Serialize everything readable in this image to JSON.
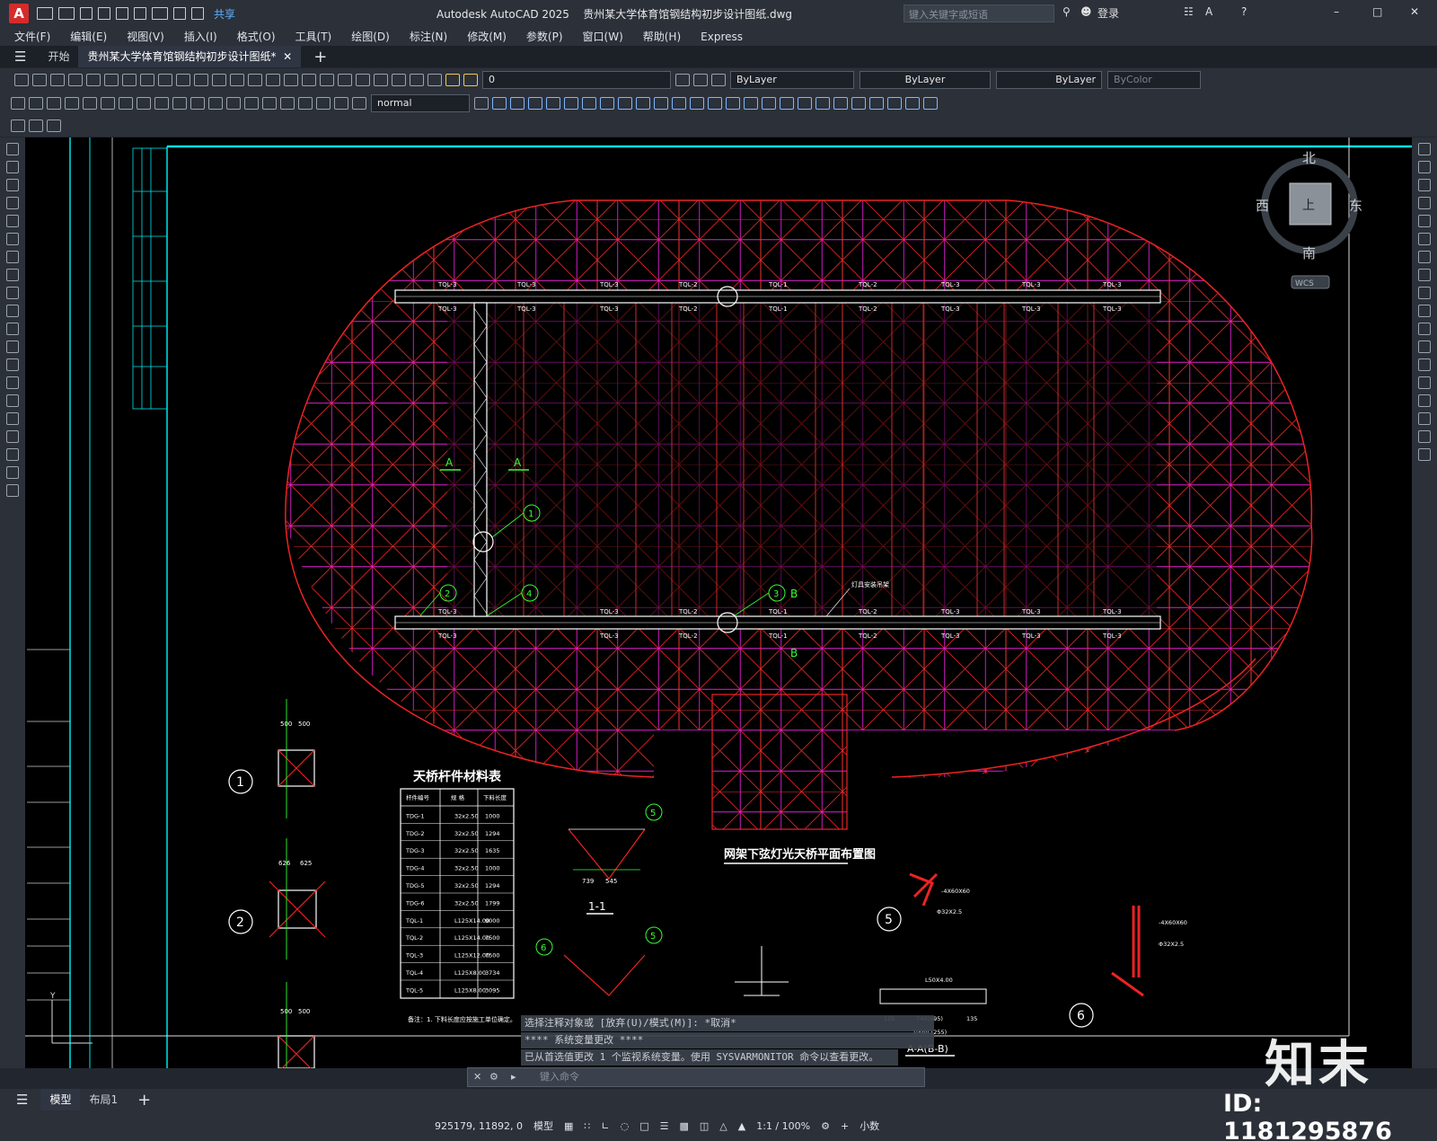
{
  "titlebar": {
    "app_name": "Autodesk AutoCAD 2025",
    "file_name": "贵州某大学体育馆钢结构初步设计图纸.dwg",
    "share_label": "共享",
    "search_placeholder": "键入关键字或短语",
    "login_label": "登录"
  },
  "menu": [
    "文件(F)",
    "编辑(E)",
    "视图(V)",
    "插入(I)",
    "格式(O)",
    "工具(T)",
    "绘图(D)",
    "标注(N)",
    "修改(M)",
    "参数(P)",
    "窗口(W)",
    "帮助(H)",
    "Express"
  ],
  "tabs": {
    "start": "开始",
    "document": "贵州某大学体育馆钢结构初步设计图纸*"
  },
  "layer": {
    "current": "0"
  },
  "properties": {
    "color": "ByLayer",
    "linetype": "ByLayer",
    "lineweight": "ByLayer",
    "plotstyle": "ByColor"
  },
  "dimstyle": "normal",
  "viewcube": {
    "north": "北",
    "south": "南",
    "east": "东",
    "west": "西",
    "top_face": "上",
    "wcs": "WCS"
  },
  "drawing": {
    "main_title": "网架下弦灯光天桥平面布置图",
    "table_title": "天桥杆件材料表",
    "table_headers": [
      "杆件编号",
      "规 格",
      "下料长度"
    ],
    "table_rows": [
      [
        "TDG-1",
        "32x2.50",
        "1000"
      ],
      [
        "TDG-2",
        "32x2.50",
        "1294"
      ],
      [
        "TDG-3",
        "32x2.50",
        "1635"
      ],
      [
        "TDG-4",
        "32x2.50",
        "1000"
      ],
      [
        "TDG-5",
        "32x2.50",
        "1294"
      ],
      [
        "TDG-6",
        "32x2.50",
        "1799"
      ],
      [
        "TQL-1",
        "L125X14.00",
        "9000"
      ],
      [
        "TQL-2",
        "L125X14.00",
        "7500"
      ],
      [
        "TQL-3",
        "L125X12.00",
        "7500"
      ],
      [
        "TQL-4",
        "L125X8.00",
        "3734"
      ],
      [
        "TQL-5",
        "L125X8.00",
        "3095"
      ]
    ],
    "table_note": "备注：1. 下料长度应按施工单位确定。",
    "bridge_labels_top": [
      "TQL-3",
      "TQL-3",
      "TQL-2",
      "TQL-1",
      "TQL-2",
      "TQL-3",
      "TQL-3",
      "TQL-3"
    ],
    "bridge_labels_bottom": [
      "TQL-3",
      "TQL-3",
      "TQL-2",
      "TQL-1",
      "TQL-2",
      "TQL-3",
      "TQL-3",
      "TQL-3"
    ],
    "section_marks": {
      "a": "A",
      "b": "B"
    },
    "callouts": [
      "1",
      "2",
      "3",
      "4",
      "5",
      "6"
    ],
    "section_titles": [
      "1-1",
      "A-A(B-B)"
    ],
    "lamp_label": "灯具安装吊架",
    "dims": {
      "d1a": "500",
      "d1b": "500",
      "d2a": "626",
      "d2b": "625",
      "d3a": "500",
      "d3b": "500",
      "d11a": "739",
      "d11b": "545",
      "aa1": "740(995)",
      "aa2": "1000(1255)",
      "aa3": "125",
      "aa4": "135",
      "det_l": "L50X4.00",
      "det_m": "-4X60X60",
      "det_p": "Φ32X2.5"
    }
  },
  "command": {
    "line1": "选择注释对象或 [放弃(U)/模式(M)]: *取消*",
    "line2": "**** 系统变量更改 ****",
    "line3": "已从首选值更改 1 个监视系统变量。使用 SYSVARMONITOR 命令以查看更改。",
    "placeholder": "键入命令"
  },
  "layout_tabs": [
    "模型",
    "布局1"
  ],
  "status": {
    "coords": "925179, 11892, 0",
    "space": "模型",
    "scale": "1:1 / 100%",
    "units": "小数"
  },
  "watermark": {
    "logo": "知末",
    "id": "ID: 1181295876"
  }
}
